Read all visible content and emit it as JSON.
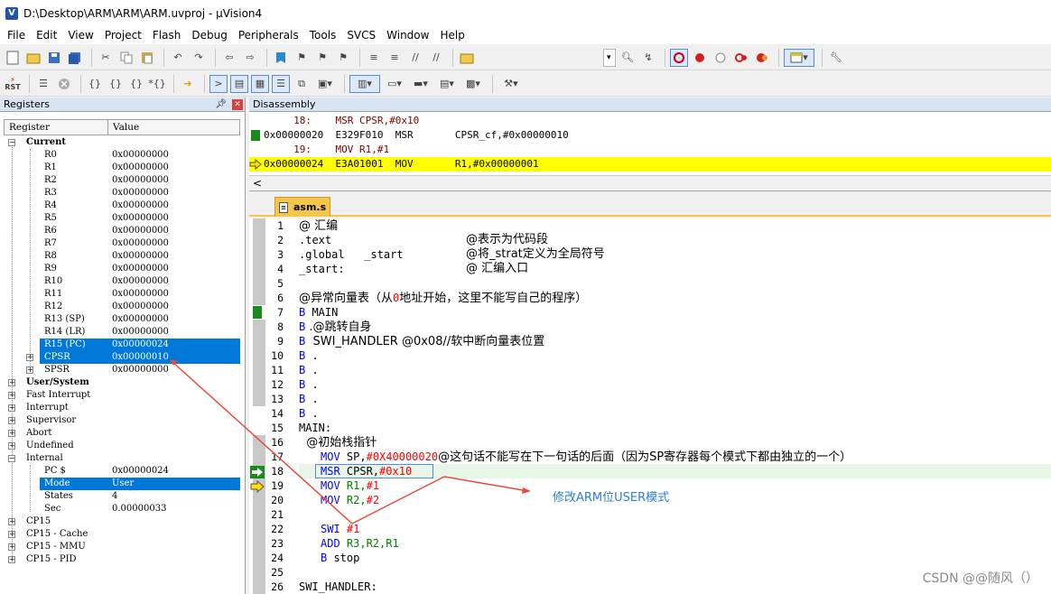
{
  "window": {
    "title": "D:\\Desktop\\ARM\\ARM\\ARM.uvproj - µVision4",
    "icon_letter": "V"
  },
  "menu": [
    "File",
    "Edit",
    "View",
    "Project",
    "Flash",
    "Debug",
    "Peripherals",
    "Tools",
    "SVCS",
    "Window",
    "Help"
  ],
  "toolbar2": {
    "rst_label": "RST"
  },
  "registers_panel": {
    "title": "Registers",
    "header_register": "Register",
    "header_value": "Value",
    "groups": {
      "current": "Current",
      "user_system": "User/System",
      "fast_interrupt": "Fast Interrupt",
      "interrupt": "Interrupt",
      "supervisor": "Supervisor",
      "abort": "Abort",
      "undefined": "Undefined",
      "internal": "Internal",
      "cp15": "CP15",
      "cp15_cache": "CP15 - Cache",
      "cp15_mmu": "CP15 - MMU",
      "cp15_pid": "CP15 - PID"
    },
    "regs": [
      {
        "name": "R0",
        "value": "0x00000000"
      },
      {
        "name": "R1",
        "value": "0x00000000"
      },
      {
        "name": "R2",
        "value": "0x00000000"
      },
      {
        "name": "R3",
        "value": "0x00000000"
      },
      {
        "name": "R4",
        "value": "0x00000000"
      },
      {
        "name": "R5",
        "value": "0x00000000"
      },
      {
        "name": "R6",
        "value": "0x00000000"
      },
      {
        "name": "R7",
        "value": "0x00000000"
      },
      {
        "name": "R8",
        "value": "0x00000000"
      },
      {
        "name": "R9",
        "value": "0x00000000"
      },
      {
        "name": "R10",
        "value": "0x00000000"
      },
      {
        "name": "R11",
        "value": "0x00000000"
      },
      {
        "name": "R12",
        "value": "0x00000000"
      },
      {
        "name": "R13 (SP)",
        "value": "0x00000000"
      },
      {
        "name": "R14 (LR)",
        "value": "0x00000000"
      },
      {
        "name": "R15 (PC)",
        "value": "0x00000024"
      },
      {
        "name": "CPSR",
        "value": "0x00000010"
      },
      {
        "name": "SPSR",
        "value": "0x00000000"
      }
    ],
    "internal": [
      {
        "name": "PC  $",
        "value": "0x00000024"
      },
      {
        "name": "Mode",
        "value": "User"
      },
      {
        "name": "States",
        "value": "4"
      },
      {
        "name": "Sec",
        "value": "0.00000033"
      }
    ]
  },
  "disassembly": {
    "title": "Disassembly",
    "lines": [
      "     18:    MSR CPSR,#0x10",
      "0x00000020  E329F010  MSR       CPSR_cf,#0x00000010",
      "     19:    MOV R1,#1",
      "0x00000024  E3A01001  MOV       R1,#0x00000001"
    ],
    "scroll_left": "<"
  },
  "editor": {
    "tab": "asm.s",
    "line_numbers": [
      "1",
      "2",
      "3",
      "4",
      "5",
      "6",
      "7",
      "8",
      "9",
      "10",
      "11",
      "12",
      "13",
      "14",
      "15",
      "16",
      "17",
      "18",
      "19",
      "20",
      "21",
      "22",
      "23",
      "24",
      "25",
      "26"
    ],
    "lines": {
      "l1": "@ 汇编",
      "l2a": ".text",
      "l2b": "@表示为代码段",
      "l3a": ".global   _start",
      "l3b": "@将_strat定义为全局符号",
      "l4a": "_start:",
      "l4b": "@ 汇编入口",
      "l6a": "@异常向量表（从",
      "l6b": "0",
      "l6c": "地址开始，这里不能写自己的程序）",
      "l7a": "B",
      "l7b": " MAIN",
      "l8a": "B",
      "l8b": " .@跳转自身",
      "l9a": "B",
      "l9b": "  SWI_HANDLER @0x08//软中断向量表位置",
      "l10a": "B",
      "l10b": " .",
      "l11a": "B",
      "l11b": " .",
      "l12a": "B",
      "l12b": " .",
      "l13a": "B",
      "l13b": " .",
      "l14a": "B",
      "l14b": " .",
      "l15": "MAIN:",
      "l16": "  @初始栈指针",
      "l17a": "MOV",
      "l17b": " SP,",
      "l17c": "#0X40000020",
      "l17d": "@这句话不能写在下一句话的后面（因为SP寄存器每个模式下都由独立的一个）",
      "l18a": "MSR",
      "l18b": " CPSR,",
      "l18c": "#0x10",
      "l19a": "MOV",
      "l19b": " R1,",
      "l19c": "#1",
      "l20a": "MOV",
      "l20b": " R2,",
      "l20c": "#2",
      "l22a": "SWI",
      "l22b": " #1",
      "l23a": "ADD",
      "l23b": " R3,R2,R1",
      "l24a": "B",
      "l24b": " stop",
      "l26": "SWI_HANDLER:"
    }
  },
  "annotation": {
    "text": "修改ARM位USER模式",
    "color": "#e84a3c"
  },
  "watermark": "CSDN @@随风（）"
}
